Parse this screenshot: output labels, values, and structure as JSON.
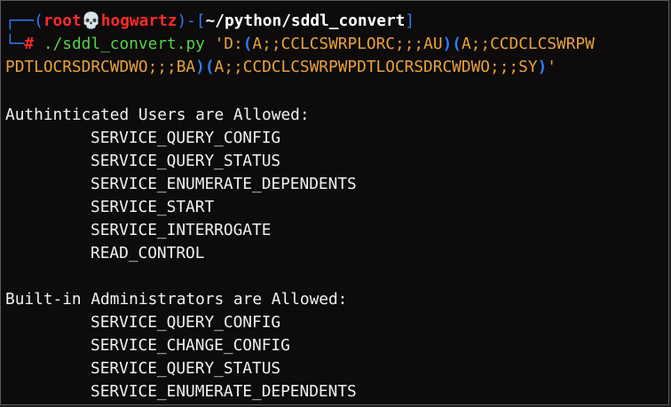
{
  "prompt": {
    "line1": {
      "box_open": "┌──(",
      "user": "root",
      "skull": "💀",
      "host": "hogwartz",
      "close_open": ")-[",
      "path": "~/python/sddl_convert",
      "close": "]"
    },
    "line2": {
      "box": "└─",
      "hash": "#",
      "command": "./sddl_convert.py",
      "arg_part1": "'D:",
      "p1_open": "(",
      "ace1": "A;;CCLCSWRPLORC;;;AU",
      "p1_close": ")",
      "p2_open": "(",
      "ace2_part1": "A;;CCDCLCSWRPW"
    },
    "line3": {
      "ace2_part2": "PDTLOCRSDRCWDWO;;;BA",
      "p2_close": ")",
      "p3_open": "(",
      "ace3": "A;;CCDCLCSWRPWPDTLOCRSDRCWDWO;;;SY",
      "p3_close": ")",
      "quote": "'"
    }
  },
  "output": {
    "group1_header": "Authinticated Users are Allowed:",
    "group1_rights": [
      "SERVICE_QUERY_CONFIG",
      "SERVICE_QUERY_STATUS",
      "SERVICE_ENUMERATE_DEPENDENTS",
      "SERVICE_START",
      "SERVICE_INTERROGATE",
      "READ_CONTROL"
    ],
    "group2_header": "Built-in Administrators are Allowed:",
    "group2_rights": [
      "SERVICE_QUERY_CONFIG",
      "SERVICE_CHANGE_CONFIG",
      "SERVICE_QUERY_STATUS",
      "SERVICE_ENUMERATE_DEPENDENTS"
    ]
  },
  "colors": {
    "background": "#0d0b0c",
    "prompt_blue": "#2f7df6",
    "prompt_red": "#ff2a2a",
    "command_green": "#56d24a",
    "string_orange": "#e8a23a",
    "text": "#f2f2f2"
  }
}
